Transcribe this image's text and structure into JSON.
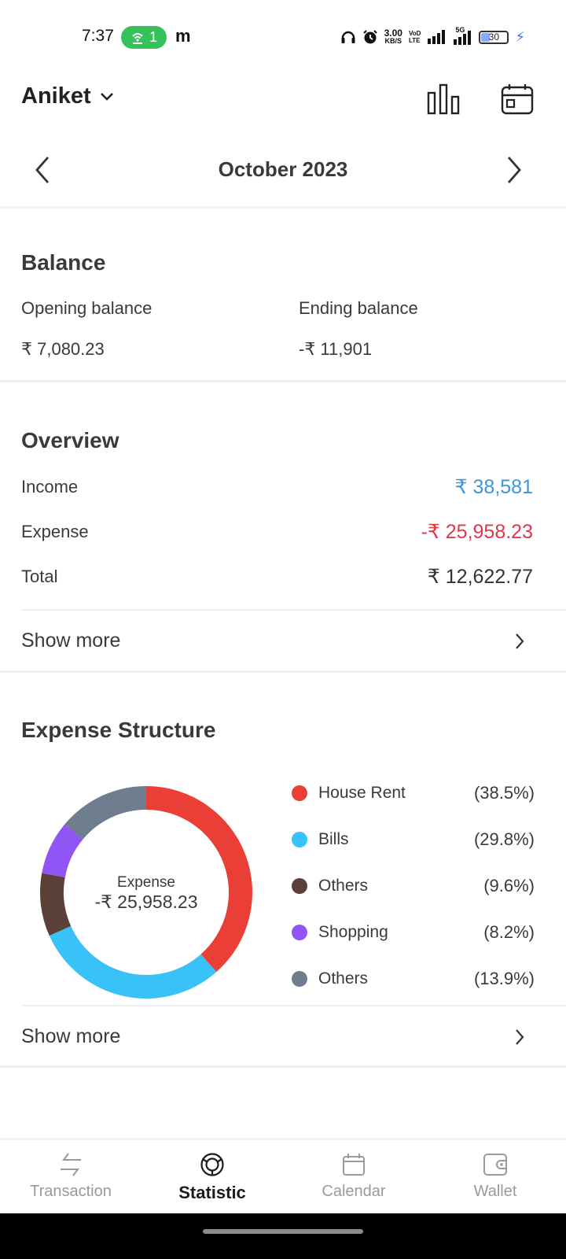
{
  "status_bar": {
    "time": "7:37",
    "hotspot_count": "1",
    "carrier_icon_text": "m",
    "net_speed_value": "3.00",
    "net_speed_unit": "KB/S",
    "volte_top": "VoD",
    "volte_bottom": "LTE",
    "network_label": "5G",
    "battery_level": "30",
    "battery_fraction": 0.3
  },
  "header": {
    "account_name": "Aniket",
    "month_label": "October 2023"
  },
  "balance": {
    "title": "Balance",
    "opening_label": "Opening balance",
    "opening_value": "₹ 7,080.23",
    "ending_label": "Ending balance",
    "ending_value": "-₹ 11,901"
  },
  "overview": {
    "title": "Overview",
    "rows": [
      {
        "label": "Income",
        "value": "₹ 38,581",
        "color": "#3d97d6"
      },
      {
        "label": "Expense",
        "value": "-₹ 25,958.23",
        "color": "#e2364b"
      },
      {
        "label": "Total",
        "value": "₹ 12,622.77",
        "color": "#333333"
      }
    ],
    "show_more": "Show more"
  },
  "expense_structure": {
    "title": "Expense Structure",
    "center_label": "Expense",
    "center_value": "-₹ 25,958.23",
    "show_more": "Show more"
  },
  "chart_data": {
    "type": "pie",
    "title": "Expense Structure",
    "donut": true,
    "center_text": [
      "Expense",
      "-₹ 25,958.23"
    ],
    "categories": [
      "House Rent",
      "Bills",
      "Others",
      "Shopping",
      "Others"
    ],
    "values": [
      38.5,
      29.8,
      9.6,
      8.2,
      13.9
    ],
    "labels": [
      "(38.5%)",
      "(29.8%)",
      "(9.6%)",
      "(8.2%)",
      "(13.9%)"
    ],
    "colors": [
      "#ea3f37",
      "#38c2f8",
      "#5b4037",
      "#9154f5",
      "#6e7e8e"
    ],
    "legend_position": "right"
  },
  "bottom_nav": {
    "tabs": [
      {
        "label": "Transaction",
        "icon": "transfer-arrows-icon",
        "active": false
      },
      {
        "label": "Statistic",
        "icon": "donut-chart-icon",
        "active": true
      },
      {
        "label": "Calendar",
        "icon": "calendar-icon",
        "active": false
      },
      {
        "label": "Wallet",
        "icon": "wallet-icon",
        "active": false
      }
    ]
  }
}
